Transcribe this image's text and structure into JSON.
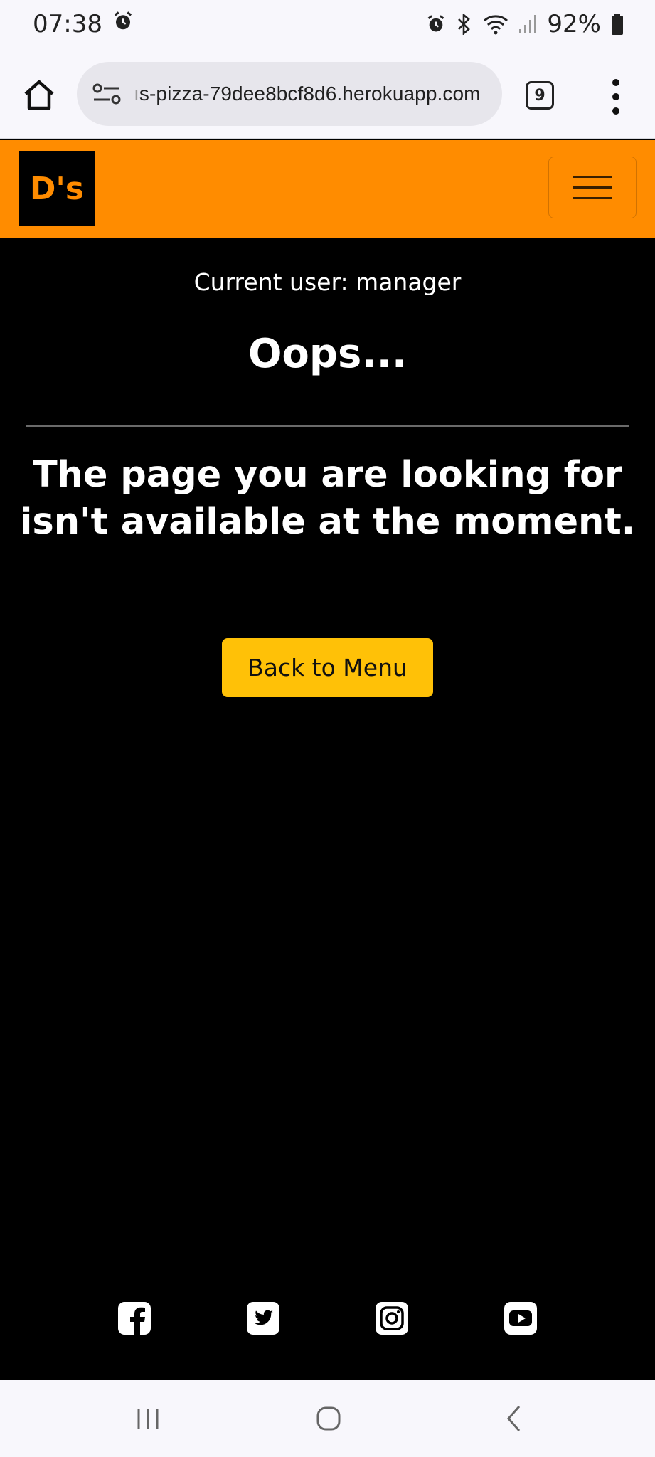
{
  "status_bar": {
    "time": "07:38",
    "battery": "92%",
    "icons": [
      "alarm-icon",
      "bluetooth-icon",
      "wifi-icon",
      "signal-icon",
      "battery-icon"
    ]
  },
  "browser": {
    "url_faded": "ı",
    "url": "s-pizza-79dee8bcf8d6.herokuapp.com",
    "tab_count": "9"
  },
  "navbar": {
    "logo_text": "D's",
    "brand_color": "#ff8c00"
  },
  "main": {
    "current_user": "Current user: manager",
    "heading": "Oops...",
    "message": "The page you are looking for isn't available at the moment.",
    "back_button": "Back to Menu",
    "button_color": "#ffc107"
  },
  "footer": {
    "social_icons": [
      "facebook-icon",
      "twitter-icon",
      "instagram-icon",
      "youtube-icon"
    ]
  }
}
